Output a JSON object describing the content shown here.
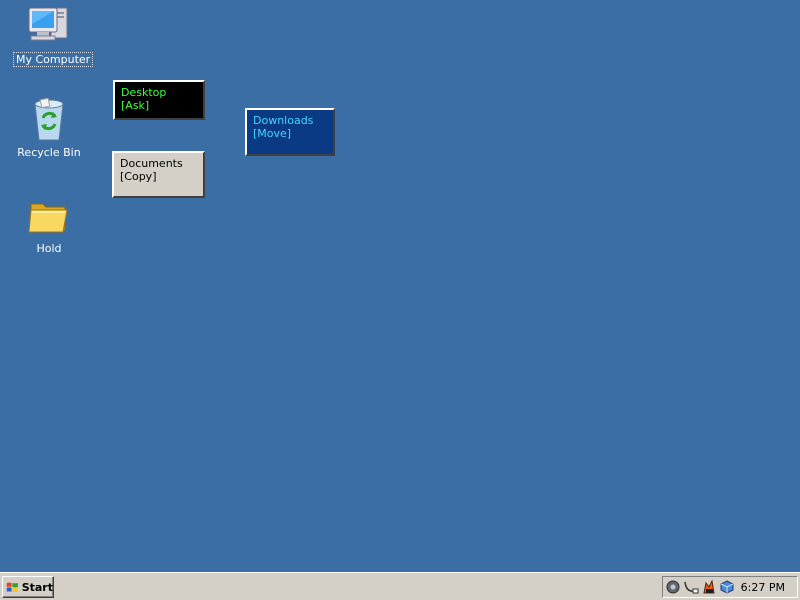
{
  "desktop": {
    "background": "#3a6ea5",
    "icons": [
      {
        "label": "My Computer",
        "icon": "my-computer-icon"
      },
      {
        "label": "Recycle Bin",
        "icon": "recycle-bin-icon"
      },
      {
        "label": "Hold",
        "icon": "folder-icon"
      }
    ],
    "drop_targets": {
      "desktop": {
        "name": "Desktop",
        "action": "[Ask]",
        "background": "#000000",
        "color": "#3cff3c"
      },
      "downloads": {
        "name": "Downloads",
        "action": "[Move]",
        "background": "#0a3a84",
        "color": "#45d4ff"
      },
      "documents": {
        "name": "Documents",
        "action": "[Copy]",
        "background": "#d4d0c8",
        "color": "#000000"
      }
    }
  },
  "taskbar": {
    "start_label": "Start",
    "tray_icons": [
      "volume-icon",
      "network-icon",
      "monitor-agent-icon",
      "cube-icon"
    ],
    "clock": "6:27 PM"
  }
}
